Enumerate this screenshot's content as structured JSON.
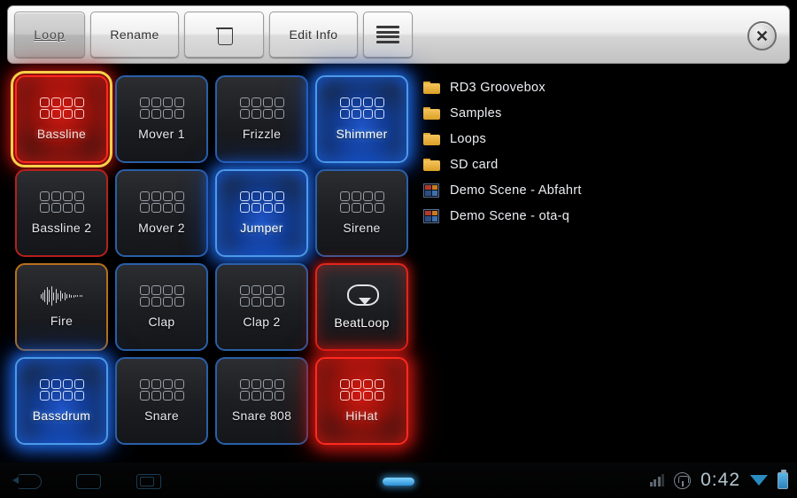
{
  "toolbar": {
    "buttons": [
      {
        "label": "Loop",
        "name": "loop-button",
        "icon": ""
      },
      {
        "label": "Rename",
        "name": "rename-button",
        "icon": ""
      },
      {
        "label": "",
        "name": "delete-button",
        "icon": "trash-icon"
      },
      {
        "label": "Edit Info",
        "name": "edit-info-button",
        "icon": ""
      },
      {
        "label": "",
        "name": "menu-button",
        "icon": "hamburger-icon"
      }
    ],
    "close_label": "✕"
  },
  "pads": [
    {
      "label": "Bassline",
      "icon": "sequencer-grid-icon",
      "state": "glow-red",
      "border": "b-red",
      "selected": true
    },
    {
      "label": "Mover 1",
      "icon": "sequencer-grid-icon",
      "state": "",
      "border": "b-blue",
      "selected": false
    },
    {
      "label": "Frizzle",
      "icon": "sequencer-grid-icon",
      "state": "",
      "border": "b-blue",
      "selected": false
    },
    {
      "label": "Shimmer",
      "icon": "sequencer-grid-icon",
      "state": "glow-blue",
      "border": "b-blue",
      "selected": false
    },
    {
      "label": "Bassline 2",
      "icon": "sequencer-grid-icon",
      "state": "",
      "border": "b-red",
      "selected": false
    },
    {
      "label": "Mover 2",
      "icon": "sequencer-grid-icon",
      "state": "",
      "border": "b-blue",
      "selected": false
    },
    {
      "label": "Jumper",
      "icon": "sequencer-grid-icon",
      "state": "glow-blue",
      "border": "b-blue",
      "selected": false
    },
    {
      "label": "Sirene",
      "icon": "sequencer-grid-icon",
      "state": "",
      "border": "b-blue",
      "selected": false
    },
    {
      "label": "Fire",
      "icon": "waveform-icon",
      "state": "",
      "border": "b-orange",
      "selected": false
    },
    {
      "label": "Clap",
      "icon": "sequencer-grid-icon",
      "state": "",
      "border": "b-blue",
      "selected": false
    },
    {
      "label": "Clap 2",
      "icon": "sequencer-grid-icon",
      "state": "",
      "border": "b-blue",
      "selected": false
    },
    {
      "label": "BeatLoop",
      "icon": "loop-arrow-icon",
      "state": "glow-red-soft",
      "border": "b-red",
      "selected": false
    },
    {
      "label": "Bassdrum",
      "icon": "sequencer-grid-icon",
      "state": "glow-blue",
      "border": "b-blue",
      "selected": false
    },
    {
      "label": "Snare",
      "icon": "sequencer-grid-icon",
      "state": "",
      "border": "b-blue",
      "selected": false
    },
    {
      "label": "Snare 808",
      "icon": "sequencer-grid-icon",
      "state": "",
      "border": "b-blue",
      "selected": false
    },
    {
      "label": "HiHat",
      "icon": "sequencer-grid-icon",
      "state": "glow-red",
      "border": "b-red",
      "selected": false
    }
  ],
  "file_list": [
    {
      "name": "RD3 Groovebox",
      "icon": "folder-icon"
    },
    {
      "name": "Samples",
      "icon": "folder-icon"
    },
    {
      "name": "Loops",
      "icon": "folder-icon"
    },
    {
      "name": "SD card",
      "icon": "folder-icon"
    },
    {
      "name": "Demo Scene - Abfahrt",
      "icon": "scene-icon"
    },
    {
      "name": "Demo Scene - ota-q",
      "icon": "scene-icon"
    }
  ],
  "system_bar": {
    "back_label": "back-icon",
    "home_label": "home-icon",
    "recents_label": "recents-icon",
    "clock": "0:42",
    "signal_icon": "signal-bars-icon",
    "sync_icon": "sync-icon",
    "wifi_icon": "wifi-icon",
    "battery_icon": "battery-icon"
  },
  "colors": {
    "accent_selected": "#f7d04a",
    "pad_blue": "#2a5fa8",
    "pad_red": "#b4201d",
    "pad_orange": "#b8701c",
    "folder_yellow": "#f5c55a",
    "status_blue": "#2f9ad6"
  }
}
